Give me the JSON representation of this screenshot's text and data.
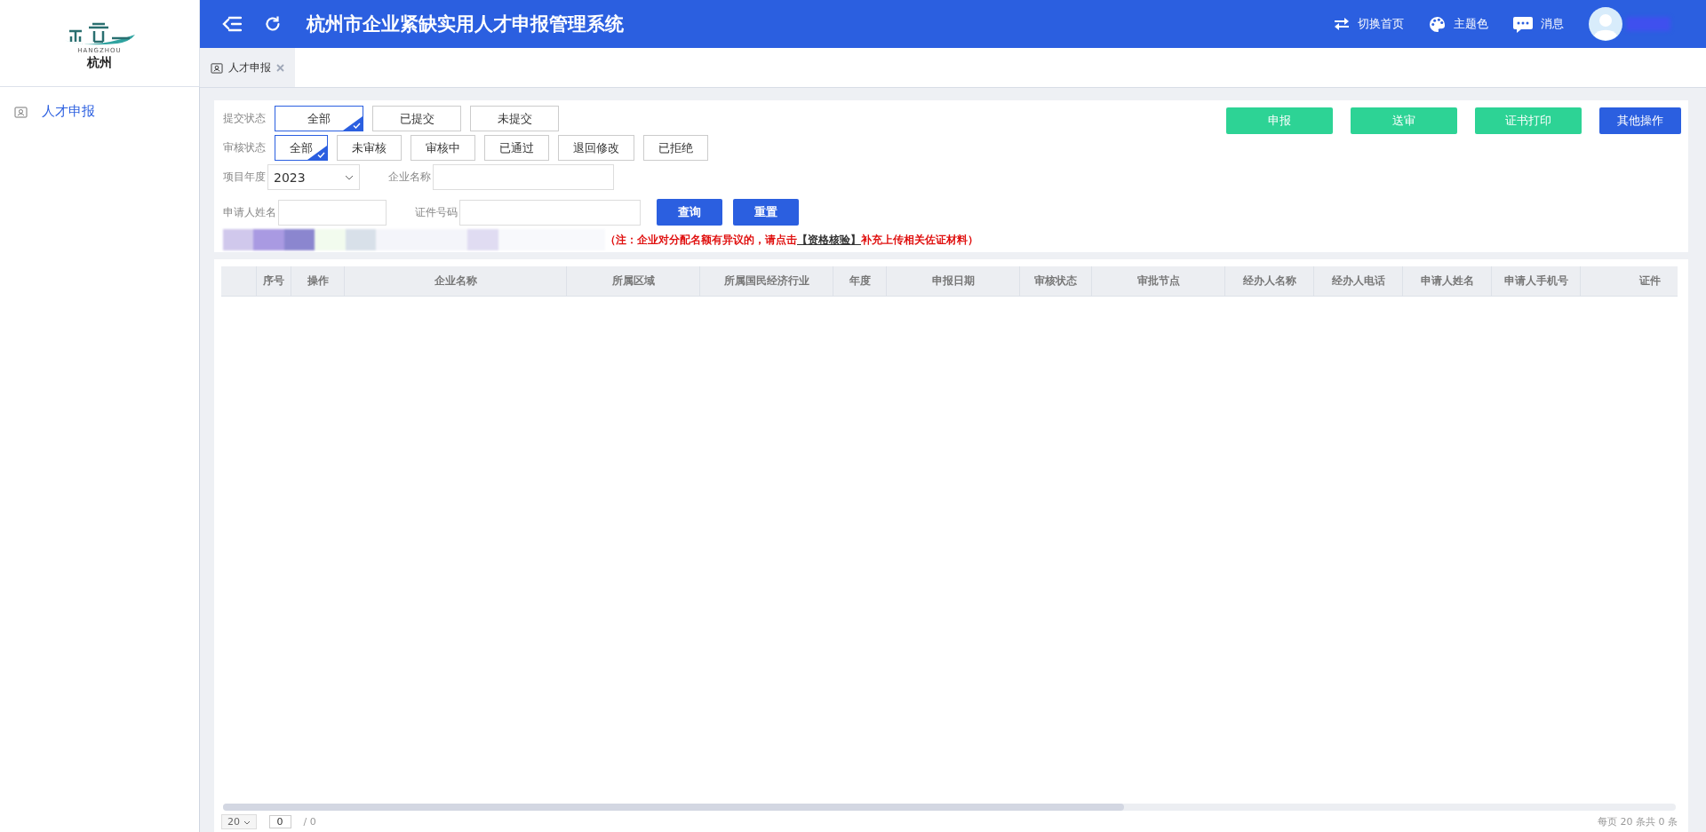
{
  "logo": {
    "subcaption": "HANGZHOU",
    "caption": "杭州"
  },
  "header": {
    "title": "杭州市企业紧缺实用人才申报管理系统",
    "actions": [
      {
        "label": "切换首页",
        "kind": "swap"
      },
      {
        "label": "主题色",
        "kind": "palette"
      },
      {
        "label": "消息",
        "kind": "chat"
      }
    ]
  },
  "sidebar": {
    "items": [
      {
        "label": "人才申报",
        "selected": true
      }
    ]
  },
  "tabs": [
    {
      "label": "人才申报",
      "selected": true
    }
  ],
  "filters": {
    "submit_status": {
      "label": "提交状态",
      "options": [
        {
          "label": "全部",
          "selected": true
        },
        {
          "label": "已提交",
          "selected": false
        },
        {
          "label": "未提交",
          "selected": false
        }
      ]
    },
    "review_status": {
      "label": "审核状态",
      "options": [
        {
          "label": "全部",
          "selected": true
        },
        {
          "label": "未审核",
          "selected": false
        },
        {
          "label": "审核中",
          "selected": false
        },
        {
          "label": "已通过",
          "selected": false
        },
        {
          "label": "退回修改",
          "selected": false
        },
        {
          "label": "已拒绝",
          "selected": false
        }
      ]
    },
    "year": {
      "label": "项目年度",
      "value": "2023"
    },
    "company": {
      "label": "企业名称"
    },
    "applicant": {
      "label": "申请人姓名"
    },
    "id_number": {
      "label": "证件号码"
    },
    "buttons": [
      {
        "label": "查询"
      },
      {
        "label": "重置"
      }
    ]
  },
  "notice": {
    "before": "（注：企业对分配名额有异议的，请点击",
    "link": "【资格核验】",
    "after": "补充上传相关佐证材料）"
  },
  "actions": [
    {
      "label": "申报",
      "kind": "success"
    },
    {
      "label": "送审",
      "kind": "success"
    },
    {
      "label": "证书打印",
      "kind": "success"
    },
    {
      "label": "其他操作",
      "kind": "primary"
    }
  ],
  "table": {
    "columns": [
      "",
      "序号",
      "操作",
      "企业名称",
      "所属区域",
      "所属国民经济行业",
      "年度",
      "申报日期",
      "审核状态",
      "审批节点",
      "经办人名称",
      "经办人电话",
      "申请人姓名",
      "申请人手机号",
      "证件"
    ]
  },
  "pager": {
    "page_size": "20",
    "page": "0",
    "total_pages": "/ 0",
    "summary": "每页 20 条共 0 条"
  }
}
